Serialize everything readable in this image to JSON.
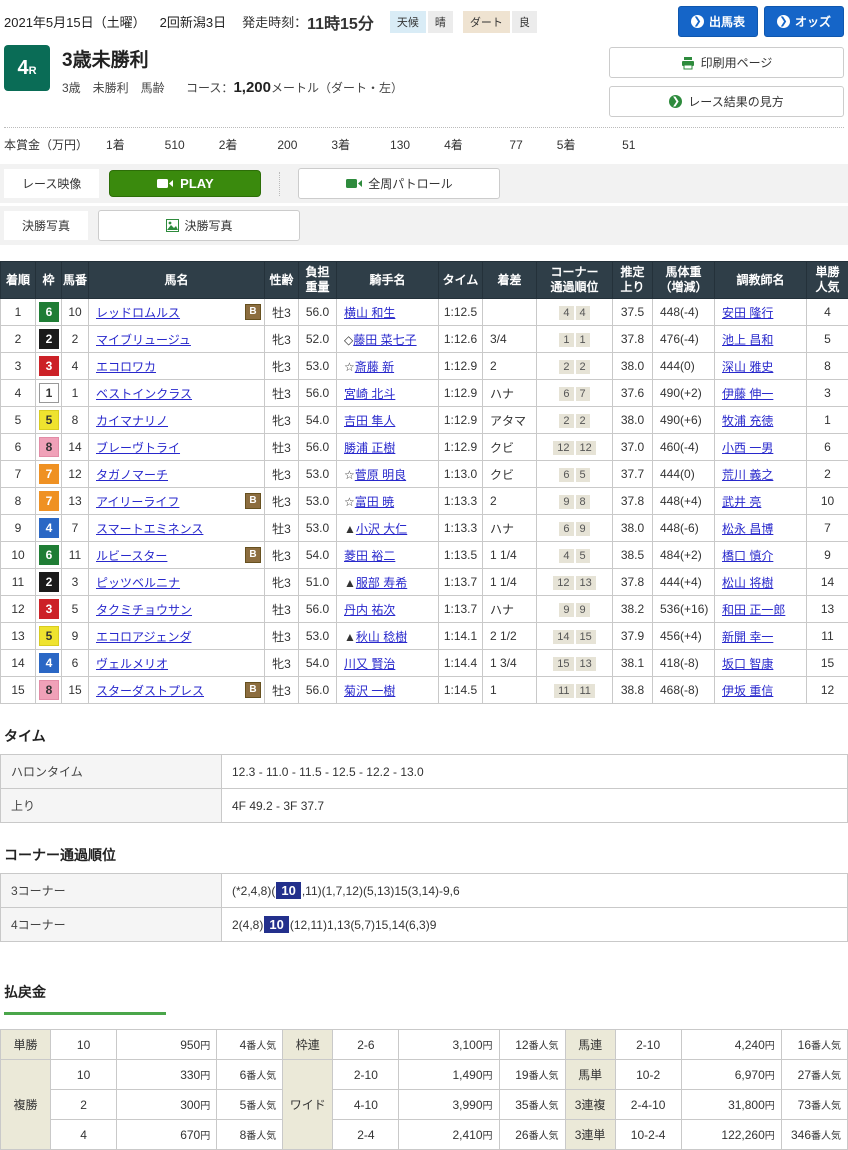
{
  "meta": {
    "date": "2021年5月15日（土曜）",
    "meeting": "2回新潟3日",
    "start_label": "発走時刻：",
    "start_time": "11時15分",
    "weather_label": "天候",
    "weather_value": "晴",
    "track_label": "ダート",
    "track_value": "良",
    "btn_shutsuba": "出馬表",
    "btn_odds": "オッズ",
    "btn_print": "印刷用ページ",
    "btn_guide": "レース結果の見方"
  },
  "race": {
    "number": "4",
    "number_suffix": "R",
    "title": "3歳未勝利",
    "conditions": "3歳　未勝利　馬齢",
    "course_label": "コース：",
    "course_value": "1,200",
    "course_unit": "メートル（ダート・左）",
    "prize_label": "本賞金（万円）",
    "prizes": [
      {
        "place": "1着",
        "amount": "510"
      },
      {
        "place": "2着",
        "amount": "200"
      },
      {
        "place": "3着",
        "amount": "130"
      },
      {
        "place": "4着",
        "amount": "77"
      },
      {
        "place": "5着",
        "amount": "51"
      }
    ]
  },
  "video": {
    "race_video_label": "レース映像",
    "play_label": "PLAY",
    "patrol_label": "全周パトロール",
    "photo_label": "決勝写真",
    "photo_button": "決勝写真"
  },
  "results": {
    "headers": [
      "着順",
      "枠",
      "馬番",
      "馬名",
      "性齢",
      "負担\n重量",
      "騎手名",
      "タイム",
      "着差",
      "コーナー\n通過順位",
      "推定\n上り",
      "馬体重\n（増減）",
      "調教師名",
      "単勝\n人気"
    ],
    "rows": [
      {
        "pos": "1",
        "waku": "6",
        "num": "10",
        "horse": "レッドロムルス",
        "blinker": true,
        "sexage": "牡3",
        "weight": "56.0",
        "jockey_prefix": "",
        "jockey": "横山 和生",
        "time": "1:12.5",
        "margin": "",
        "corners": [
          "4",
          "4"
        ],
        "last3f": "37.5",
        "body": "448(-4)",
        "trainer": "安田 隆行",
        "pop": "4"
      },
      {
        "pos": "2",
        "waku": "2",
        "num": "2",
        "horse": "マイブリュージュ",
        "blinker": false,
        "sexage": "牝3",
        "weight": "52.0",
        "jockey_prefix": "◇",
        "jockey": "藤田 菜七子",
        "time": "1:12.6",
        "margin": "3/4",
        "corners": [
          "1",
          "1"
        ],
        "last3f": "37.8",
        "body": "476(-4)",
        "trainer": "池上 昌和",
        "pop": "5"
      },
      {
        "pos": "3",
        "waku": "3",
        "num": "4",
        "horse": "エコロワカ",
        "blinker": false,
        "sexage": "牝3",
        "weight": "53.0",
        "jockey_prefix": "☆",
        "jockey": "斎藤 新",
        "time": "1:12.9",
        "margin": "2",
        "corners": [
          "2",
          "2"
        ],
        "last3f": "38.0",
        "body": "444(0)",
        "trainer": "深山 雅史",
        "pop": "8"
      },
      {
        "pos": "4",
        "waku": "1",
        "num": "1",
        "horse": "ベストインクラス",
        "blinker": false,
        "sexage": "牡3",
        "weight": "56.0",
        "jockey_prefix": "",
        "jockey": "宮崎 北斗",
        "time": "1:12.9",
        "margin": "ハナ",
        "corners": [
          "6",
          "7"
        ],
        "last3f": "37.6",
        "body": "490(+2)",
        "trainer": "伊藤 伸一",
        "pop": "3"
      },
      {
        "pos": "5",
        "waku": "5",
        "num": "8",
        "horse": "カイマナリノ",
        "blinker": false,
        "sexage": "牝3",
        "weight": "54.0",
        "jockey_prefix": "",
        "jockey": "吉田 隼人",
        "time": "1:12.9",
        "margin": "アタマ",
        "corners": [
          "2",
          "2"
        ],
        "last3f": "38.0",
        "body": "490(+6)",
        "trainer": "牧浦 充徳",
        "pop": "1"
      },
      {
        "pos": "6",
        "waku": "8",
        "num": "14",
        "horse": "ブレーヴトライ",
        "blinker": false,
        "sexage": "牡3",
        "weight": "56.0",
        "jockey_prefix": "",
        "jockey": "勝浦 正樹",
        "time": "1:12.9",
        "margin": "クビ",
        "corners": [
          "12",
          "12"
        ],
        "last3f": "37.0",
        "body": "460(-4)",
        "trainer": "小西 一男",
        "pop": "6"
      },
      {
        "pos": "7",
        "waku": "7",
        "num": "12",
        "horse": "タガノマーチ",
        "blinker": false,
        "sexage": "牝3",
        "weight": "53.0",
        "jockey_prefix": "☆",
        "jockey": "菅原 明良",
        "time": "1:13.0",
        "margin": "クビ",
        "corners": [
          "6",
          "5"
        ],
        "last3f": "37.7",
        "body": "444(0)",
        "trainer": "荒川 義之",
        "pop": "2"
      },
      {
        "pos": "8",
        "waku": "7",
        "num": "13",
        "horse": "アイリーライフ",
        "blinker": true,
        "sexage": "牝3",
        "weight": "53.0",
        "jockey_prefix": "☆",
        "jockey": "富田 暁",
        "time": "1:13.3",
        "margin": "2",
        "corners": [
          "9",
          "8"
        ],
        "last3f": "37.8",
        "body": "448(+4)",
        "trainer": "武井 亮",
        "pop": "10"
      },
      {
        "pos": "9",
        "waku": "4",
        "num": "7",
        "horse": "スマートエミネンス",
        "blinker": false,
        "sexage": "牡3",
        "weight": "53.0",
        "jockey_prefix": "▲",
        "jockey": "小沢 大仁",
        "time": "1:13.3",
        "margin": "ハナ",
        "corners": [
          "6",
          "9"
        ],
        "last3f": "38.0",
        "body": "448(-6)",
        "trainer": "松永 昌博",
        "pop": "7"
      },
      {
        "pos": "10",
        "waku": "6",
        "num": "11",
        "horse": "ルビースター",
        "blinker": true,
        "sexage": "牝3",
        "weight": "54.0",
        "jockey_prefix": "",
        "jockey": "菱田 裕二",
        "time": "1:13.5",
        "margin": "1 1/4",
        "corners": [
          "4",
          "5"
        ],
        "last3f": "38.5",
        "body": "484(+2)",
        "trainer": "橋口 慎介",
        "pop": "9"
      },
      {
        "pos": "11",
        "waku": "2",
        "num": "3",
        "horse": "ピッツベルニナ",
        "blinker": false,
        "sexage": "牝3",
        "weight": "51.0",
        "jockey_prefix": "▲",
        "jockey": "服部 寿希",
        "time": "1:13.7",
        "margin": "1 1/4",
        "corners": [
          "12",
          "13"
        ],
        "last3f": "37.8",
        "body": "444(+4)",
        "trainer": "松山 将樹",
        "pop": "14"
      },
      {
        "pos": "12",
        "waku": "3",
        "num": "5",
        "horse": "タクミチョウサン",
        "blinker": false,
        "sexage": "牡3",
        "weight": "56.0",
        "jockey_prefix": "",
        "jockey": "丹内 祐次",
        "time": "1:13.7",
        "margin": "ハナ",
        "corners": [
          "9",
          "9"
        ],
        "last3f": "38.2",
        "body": "536(+16)",
        "trainer": "和田 正一郎",
        "pop": "13"
      },
      {
        "pos": "13",
        "waku": "5",
        "num": "9",
        "horse": "エコロアジェンダ",
        "blinker": false,
        "sexage": "牡3",
        "weight": "53.0",
        "jockey_prefix": "▲",
        "jockey": "秋山 稔樹",
        "time": "1:14.1",
        "margin": "2 1/2",
        "corners": [
          "14",
          "15"
        ],
        "last3f": "37.9",
        "body": "456(+4)",
        "trainer": "新開 幸一",
        "pop": "11"
      },
      {
        "pos": "14",
        "waku": "4",
        "num": "6",
        "horse": "ヴェルメリオ",
        "blinker": false,
        "sexage": "牝3",
        "weight": "54.0",
        "jockey_prefix": "",
        "jockey": "川又 賢治",
        "time": "1:14.4",
        "margin": "1 3/4",
        "corners": [
          "15",
          "13"
        ],
        "last3f": "38.1",
        "body": "418(-8)",
        "trainer": "坂口 智康",
        "pop": "15"
      },
      {
        "pos": "15",
        "waku": "8",
        "num": "15",
        "horse": "スターダストプレス",
        "blinker": true,
        "sexage": "牡3",
        "weight": "56.0",
        "jockey_prefix": "",
        "jockey": "菊沢 一樹",
        "time": "1:14.5",
        "margin": "1",
        "corners": [
          "11",
          "11"
        ],
        "last3f": "38.8",
        "body": "468(-8)",
        "trainer": "伊坂 重信",
        "pop": "12"
      }
    ]
  },
  "time_section": {
    "heading": "タイム",
    "rows": [
      {
        "label": "ハロンタイム",
        "value": "12.3 - 11.0 - 11.5 - 12.5 - 12.2 - 13.0"
      },
      {
        "label": "上り",
        "value": "4F 49.2 - 3F 37.7"
      }
    ]
  },
  "corner_section": {
    "heading": "コーナー通過順位",
    "rows": [
      {
        "label": "3コーナー",
        "segments": [
          {
            "text": "(*2,4,8)("
          },
          {
            "text": "10",
            "highlight": true
          },
          {
            "text": ",11)(1,7,12)(5,13)15(3,14)-9,6"
          }
        ]
      },
      {
        "label": "4コーナー",
        "segments": [
          {
            "text": "2(4,8)"
          },
          {
            "text": "10",
            "highlight": true
          },
          {
            "text": "(12,11)1,13(5,7)15,14(6,3)9"
          }
        ]
      }
    ]
  },
  "payout": {
    "heading": "払戻金",
    "yen_suffix": "円",
    "ninki_suffix": "番人気",
    "groups": [
      {
        "rows": [
          {
            "label": "単勝",
            "span": 1,
            "bets": [
              {
                "num": "10",
                "amount": "950",
                "ninki": "4"
              }
            ]
          },
          {
            "label": "複勝",
            "span": 3,
            "bets": [
              {
                "num": "10",
                "amount": "330",
                "ninki": "6"
              },
              {
                "num": "2",
                "amount": "300",
                "ninki": "5"
              },
              {
                "num": "4",
                "amount": "670",
                "ninki": "8"
              }
            ]
          }
        ]
      },
      {
        "rows": [
          {
            "label": "枠連",
            "span": 1,
            "bets": [
              {
                "num": "2-6",
                "amount": "3,100",
                "ninki": "12"
              }
            ]
          },
          {
            "label": "ワイド",
            "span": 3,
            "bets": [
              {
                "num": "2-10",
                "amount": "1,490",
                "ninki": "19"
              },
              {
                "num": "4-10",
                "amount": "3,990",
                "ninki": "35"
              },
              {
                "num": "2-4",
                "amount": "2,410",
                "ninki": "26"
              }
            ]
          }
        ]
      },
      {
        "rows": [
          {
            "label": "馬連",
            "span": 1,
            "bets": [
              {
                "num": "2-10",
                "amount": "4,240",
                "ninki": "16"
              }
            ]
          },
          {
            "label": "馬単",
            "span": 1,
            "bets": [
              {
                "num": "10-2",
                "amount": "6,970",
                "ninki": "27"
              }
            ]
          },
          {
            "label": "3連複",
            "span": 1,
            "bets": [
              {
                "num": "2-4-10",
                "amount": "31,800",
                "ninki": "73"
              }
            ]
          },
          {
            "label": "3連単",
            "span": 1,
            "bets": [
              {
                "num": "10-2-4",
                "amount": "122,260",
                "ninki": "346"
              }
            ]
          }
        ]
      }
    ]
  },
  "colors": {
    "waku": {
      "1": {
        "bg": "#ffffff",
        "fg": "#333333",
        "border": "#999999"
      },
      "2": {
        "bg": "#1a1a1a",
        "fg": "#ffffff",
        "border": "#1a1a1a"
      },
      "3": {
        "bg": "#cc2127",
        "fg": "#ffffff",
        "border": "#cc2127"
      },
      "4": {
        "bg": "#2a67c5",
        "fg": "#ffffff",
        "border": "#2a67c5"
      },
      "5": {
        "bg": "#efe32f",
        "fg": "#333333",
        "border": "#d8cc20"
      },
      "6": {
        "bg": "#1f7d35",
        "fg": "#ffffff",
        "border": "#1f7d35"
      },
      "7": {
        "bg": "#ef9123",
        "fg": "#ffffff",
        "border": "#ef9123"
      },
      "8": {
        "bg": "#f0a1b8",
        "fg": "#333333",
        "border": "#e28ca6"
      }
    },
    "accent_blue": "#1565c8",
    "accent_green": "#3a8a0d",
    "race_badge_green": "#0a6c56",
    "highlight_navy": "#23308c"
  }
}
